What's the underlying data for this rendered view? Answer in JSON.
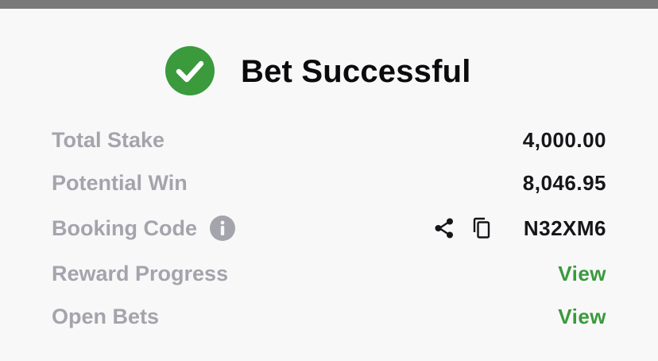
{
  "header": {
    "title": "Bet Successful"
  },
  "summary": {
    "total_stake_label": "Total Stake",
    "total_stake_value": "4,000.00",
    "potential_win_label": "Potential Win",
    "potential_win_value": "8,046.95",
    "booking_code_label": "Booking Code",
    "booking_code_value": "N32XM6",
    "reward_progress_label": "Reward Progress",
    "reward_progress_link": "View",
    "open_bets_label": "Open Bets",
    "open_bets_link": "View"
  },
  "icons": {
    "success": "check-circle-icon",
    "info": "info-icon",
    "share": "share-icon",
    "copy": "copy-icon"
  },
  "colors": {
    "success_green": "#3a9a3c",
    "label_gray": "#a4a4ac",
    "value_dark": "#16161a",
    "background": "#f8f8f9"
  }
}
